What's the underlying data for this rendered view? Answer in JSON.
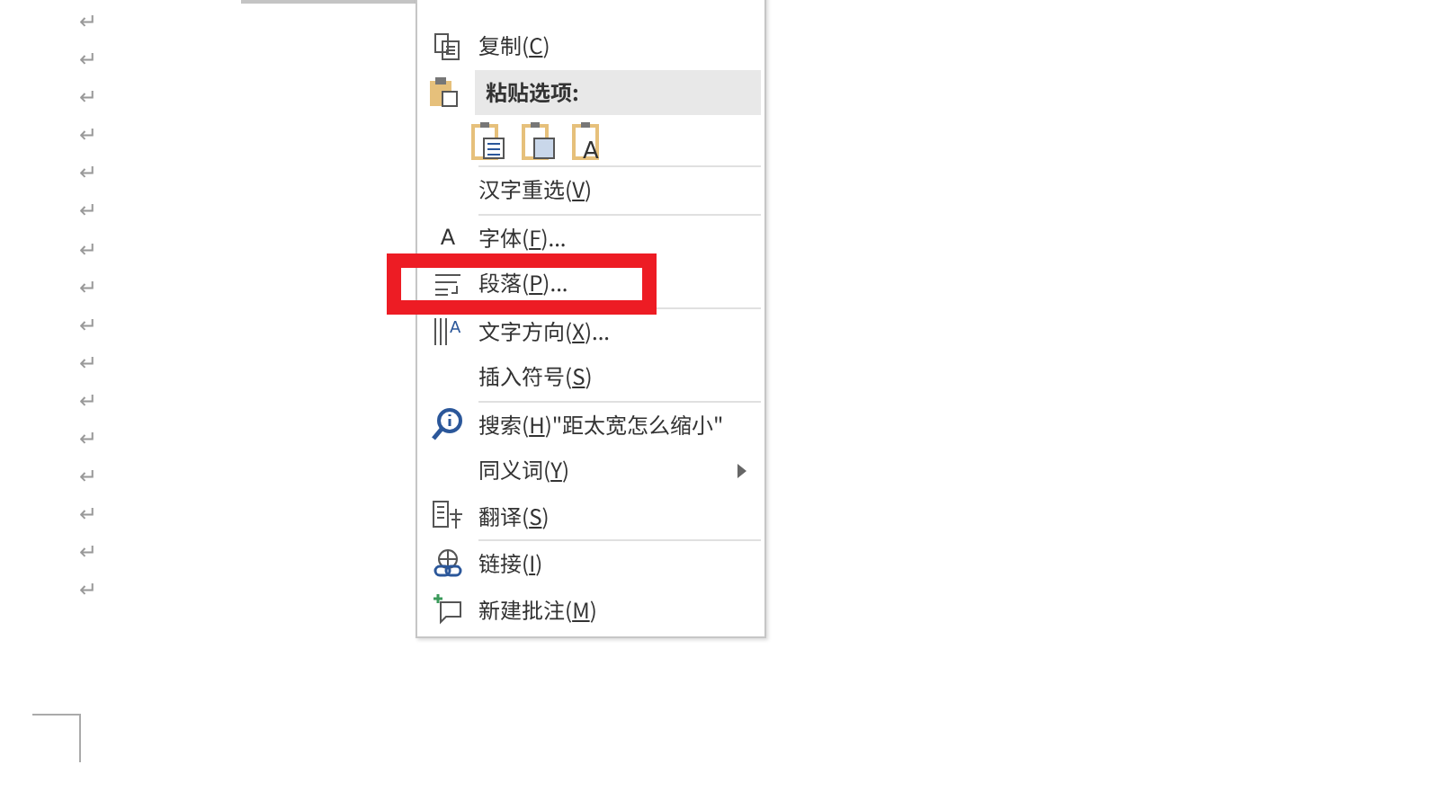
{
  "document": {
    "paragraph_marks": [
      "↵",
      "↵",
      "↵",
      "↵",
      "↵",
      "↵",
      "↵",
      "↵",
      "↵",
      "↵",
      "↵",
      "↵",
      "↵",
      "↵",
      "↵",
      "↵"
    ]
  },
  "context_menu": {
    "items": [
      {
        "kind": "blank"
      },
      {
        "kind": "item",
        "before": "复制(",
        "key": "C",
        "after": ")",
        "submenu": false
      },
      {
        "kind": "header",
        "before": "粘贴选项:"
      },
      {
        "kind": "paste",
        "letter": "A"
      },
      {
        "kind": "separator"
      },
      {
        "kind": "item",
        "before": "汉字重选(",
        "key": "V",
        "after": ")",
        "submenu": false
      },
      {
        "kind": "separator"
      },
      {
        "kind": "item",
        "glyph": "A",
        "before": "字体(",
        "key": "F",
        "after": ")...",
        "submenu": false
      },
      {
        "kind": "item",
        "before": "段落(",
        "key": "P",
        "after": ")...",
        "submenu": false
      },
      {
        "kind": "separator"
      },
      {
        "kind": "item",
        "glyph": "A",
        "before": "文字方向(",
        "key": "X",
        "after": ")...",
        "submenu": false
      },
      {
        "kind": "item",
        "before": "插入符号(",
        "key": "S",
        "after": ")",
        "submenu": false
      },
      {
        "kind": "separator"
      },
      {
        "kind": "item",
        "before": "搜索(",
        "key": "H",
        "after": ")\"距太宽怎么缩小\"",
        "submenu": false
      },
      {
        "kind": "item",
        "before": "同义词(",
        "key": "Y",
        "after": ")",
        "submenu": true
      },
      {
        "kind": "item",
        "before": "翻译(",
        "key": "S",
        "after": ")",
        "submenu": false
      },
      {
        "kind": "separator"
      },
      {
        "kind": "item",
        "before": "链接(",
        "key": "I",
        "after": ")",
        "submenu": false
      },
      {
        "kind": "item",
        "before": "新建批注(",
        "key": "M",
        "after": ")",
        "submenu": false
      }
    ]
  }
}
